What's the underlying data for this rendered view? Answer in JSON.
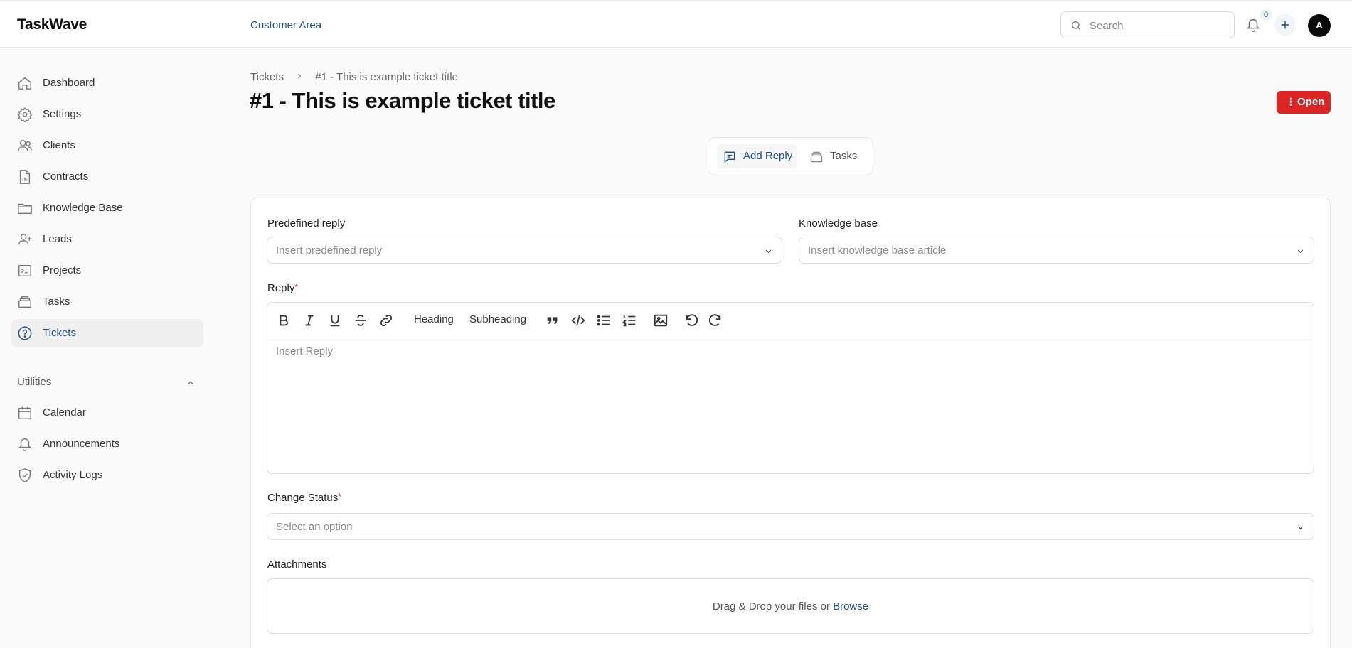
{
  "app": {
    "name": "TaskWave",
    "area_link": "Customer Area"
  },
  "header": {
    "search_placeholder": "Search",
    "notification_count": "0",
    "avatar_initial": "A"
  },
  "sidebar": {
    "items": [
      {
        "label": "Dashboard",
        "icon": "home-icon"
      },
      {
        "label": "Settings",
        "icon": "gear-icon"
      },
      {
        "label": "Clients",
        "icon": "users-icon"
      },
      {
        "label": "Contracts",
        "icon": "document-chart-icon"
      },
      {
        "label": "Knowledge Base",
        "icon": "folder-icon"
      },
      {
        "label": "Leads",
        "icon": "user-plus-icon"
      },
      {
        "label": "Projects",
        "icon": "terminal-icon"
      },
      {
        "label": "Tasks",
        "icon": "stack-icon"
      },
      {
        "label": "Tickets",
        "icon": "question-circle-icon",
        "active": true
      }
    ],
    "utilities_title": "Utilities",
    "utilities": [
      {
        "label": "Calendar",
        "icon": "calendar-icon"
      },
      {
        "label": "Announcements",
        "icon": "bell-icon"
      },
      {
        "label": "Activity Logs",
        "icon": "shield-check-icon"
      }
    ]
  },
  "breadcrumb": {
    "parent": "Tickets",
    "current": "#1 - This is example ticket title"
  },
  "page": {
    "title": "#1 - This is example ticket title",
    "status_button": "Open",
    "status_color": "#dc2626"
  },
  "tabs": [
    {
      "label": "Add Reply",
      "active": true
    },
    {
      "label": "Tasks",
      "active": false
    }
  ],
  "form": {
    "predefined_label": "Predefined reply",
    "predefined_placeholder": "Insert predefined reply",
    "kb_label": "Knowledge base",
    "kb_placeholder": "Insert knowledge base article",
    "reply_label": "Reply",
    "required_mark": "*",
    "toolbar": {
      "heading": "Heading",
      "subheading": "Subheading"
    },
    "reply_placeholder": "Insert Reply",
    "status_label": "Change Status",
    "status_placeholder": "Select an option",
    "attachments_label": "Attachments",
    "dropzone_text": "Drag & Drop your files or",
    "dropzone_browse": "Browse"
  },
  "colors": {
    "accent": "#1e4e8c",
    "danger": "#dc2626"
  }
}
